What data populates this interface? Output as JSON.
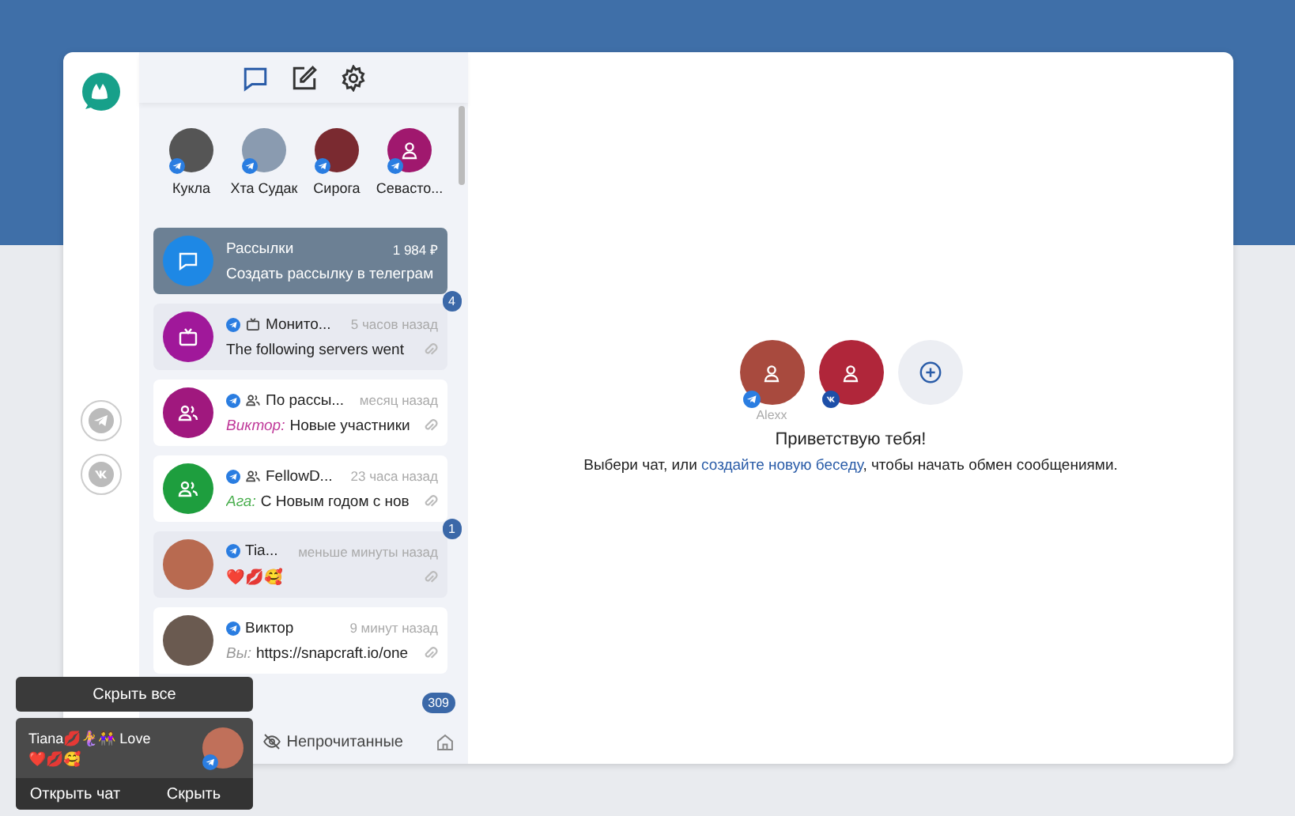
{
  "toolbar": [
    {
      "selected": true
    },
    {
      "selected": false
    },
    {
      "selected": false
    }
  ],
  "stories": [
    {
      "name": "Кукла",
      "photo": true,
      "color": "#555555"
    },
    {
      "name": "Хта Судак",
      "photo": true,
      "color": "#8a9bb0"
    },
    {
      "name": "Сирога",
      "photo": true,
      "color": "#7a2a30"
    },
    {
      "name": "Севасто...",
      "photo": false,
      "color": "#a0186e"
    }
  ],
  "accounts": [
    {
      "kind": "telegram"
    },
    {
      "kind": "vk"
    }
  ],
  "chats": [
    {
      "kind": "mailing",
      "selected": true,
      "name": "Рассылки",
      "time": "1 984 ₽",
      "preview": "Создать рассылку в телеграм",
      "photo": false,
      "color": "#1e88e5"
    },
    {
      "kind": "channel",
      "selected": false,
      "unread": true,
      "badge": "4",
      "name": "Монито...",
      "time": "5 часов назад",
      "preview": "The following servers went",
      "photo": false,
      "color": "#a0189a"
    },
    {
      "kind": "group",
      "selected": false,
      "unread": false,
      "name": "По рассы...",
      "time": "месяц назад",
      "sender": {
        "text": "Виктор:",
        "color": "#c03a9a"
      },
      "preview": "Новые участники",
      "photo": false,
      "color": "#a0187e"
    },
    {
      "kind": "group",
      "selected": false,
      "unread": false,
      "name": "FellowD...",
      "time": "23 часа назад",
      "sender": {
        "text": "Ага:",
        "color": "#4caf50"
      },
      "preview": "С Новым годом с нов",
      "photo": false,
      "color": "#1e9e3e"
    },
    {
      "kind": "direct",
      "selected": false,
      "unread": true,
      "badge": "1",
      "name": "Tia...",
      "time": "меньше минуты назад",
      "preview": "❤️💋🥰",
      "photo": true,
      "color": "#b86a50"
    },
    {
      "kind": "direct",
      "selected": false,
      "unread": false,
      "name": "Виктор",
      "time": "9 минут назад",
      "sender": {
        "text": "Вы:",
        "color": "#999999"
      },
      "preview": "https://snapcraft.io/one",
      "photo": true,
      "color": "#6a5a50"
    }
  ],
  "list_badge": "309",
  "bottom_tab": "Непрочитанные",
  "profiles": [
    {
      "name": "Alexx",
      "kind": "telegram",
      "color": "#a84a3e"
    },
    {
      "kind": "vk",
      "color": "#b0263a"
    }
  ],
  "welcome": {
    "title": "Приветствую тебя!",
    "before": "Выбери чат, или ",
    "link": "создайте новую беседу",
    "after": ", чтобы начать обмен сообщениями."
  },
  "toast": {
    "hide_all": "Скрыть все",
    "title": "Tiana💋🧜‍♀️👭 Love",
    "text": "❤️💋🥰",
    "buttons": [
      "Открыть чат",
      "Скрыть"
    ]
  }
}
